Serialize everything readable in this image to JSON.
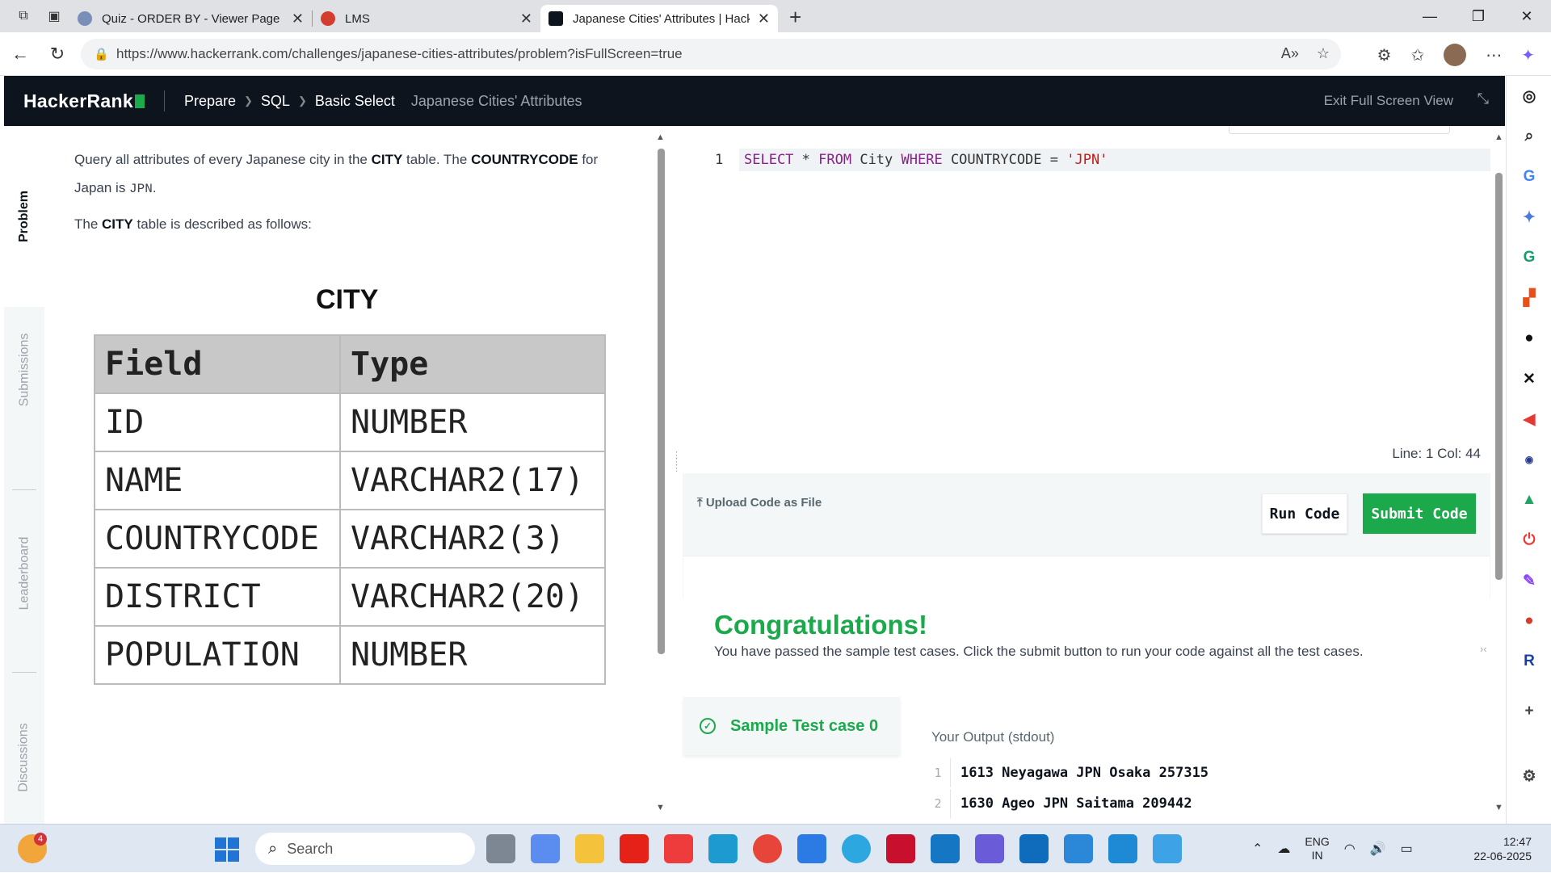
{
  "browser": {
    "tabs": [
      {
        "title": "Quiz - ORDER BY - Viewer Page | I",
        "favicon_color": "#7a8fb8",
        "active": false
      },
      {
        "title": "LMS",
        "favicon_color": "#d43c2f",
        "active": false
      },
      {
        "title": "Japanese Cities' Attributes | Hacke",
        "favicon_color": "#0e141e",
        "active": true
      }
    ],
    "new_tab": "+",
    "url": "https://www.hackerrank.com/challenges/japanese-cities-attributes/problem?isFullScreen=true",
    "window_controls": [
      "—",
      "❐",
      "✕"
    ]
  },
  "header": {
    "logo": "HackerRank",
    "breadcrumbs": [
      "Prepare",
      "SQL",
      "Basic Select"
    ],
    "current": "Japanese Cities' Attributes",
    "exit_fullscreen": "Exit Full Screen View"
  },
  "side_tabs": [
    "Problem",
    "Submissions",
    "Leaderboard",
    "Discussions"
  ],
  "problem": {
    "p1_a": "Query all attributes of every Japanese city in the ",
    "p1_b": "CITY",
    "p1_c": " table. The ",
    "p1_d": "COUNTRYCODE",
    "p1_e": " for Japan is ",
    "p1_f": "JPN",
    "p1_g": ".",
    "p2_a": "The ",
    "p2_b": "CITY",
    "p2_c": " table is described as follows:",
    "table_title": "CITY",
    "table_headers": [
      "Field",
      "Type"
    ],
    "table_rows": [
      [
        "ID",
        "NUMBER"
      ],
      [
        "NAME",
        "VARCHAR2(17)"
      ],
      [
        "COUNTRYCODE",
        "VARCHAR2(3)"
      ],
      [
        "DISTRICT",
        "VARCHAR2(20)"
      ],
      [
        "POPULATION",
        "NUMBER"
      ]
    ]
  },
  "editor": {
    "line_number": "1",
    "code_parts": [
      "SELECT",
      " * ",
      "FROM",
      " City ",
      "WHERE",
      " COUNTRYCODE = ",
      "'JPN'"
    ],
    "status": "Line: 1 Col: 44",
    "upload_label": "Upload Code as File",
    "run_label": "Run Code",
    "submit_label": "Submit Code"
  },
  "results": {
    "title": "Congratulations!",
    "message": "You have passed the sample test cases. Click the submit button to run your code against all the test cases.",
    "testcase_label": "Sample Test case 0",
    "output_label": "Your Output (stdout)",
    "output_lines": [
      {
        "n": "1",
        "text": "1613 Neyagawa JPN Osaka 257315"
      },
      {
        "n": "2",
        "text": "1630 Ageo JPN Saitama 209442"
      }
    ]
  },
  "taskbar": {
    "weather_badge": "4",
    "search_placeholder": "Search",
    "tray_lang_1": "ENG",
    "tray_lang_2": "IN",
    "time": "12:47",
    "date": "22-06-2025"
  },
  "colors": {
    "brand_green": "#1ba94c",
    "header_bg": "#0e141e"
  }
}
